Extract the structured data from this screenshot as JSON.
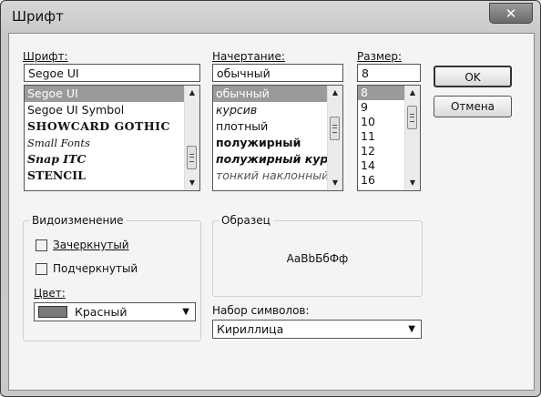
{
  "window": {
    "title": "Шрифт"
  },
  "font": {
    "label": "Шрифт:",
    "value": "Segoe UI",
    "items": [
      "Segoe UI",
      "Segoe UI Symbol",
      "SHOWCARD GOTHIC",
      "Small Fonts",
      "Snap ITC",
      "STENCIL"
    ]
  },
  "style": {
    "label": "Начертание:",
    "value": "обычный",
    "items": [
      "обычный",
      "курсив",
      "плотный",
      "полужирный",
      "полужирный курсив",
      "тонкий наклонный"
    ]
  },
  "size": {
    "label": "Размер:",
    "value": "8",
    "items": [
      "8",
      "9",
      "10",
      "11",
      "12",
      "14",
      "16"
    ]
  },
  "buttons": {
    "ok": "OK",
    "cancel": "Отмена"
  },
  "effects": {
    "title": "Видоизменение",
    "strikeout": "Зачеркнутый",
    "underline": "Подчеркнутый",
    "color_label": "Цвет:",
    "color_value": "Красный",
    "swatch_color": "#7a7a7a"
  },
  "sample": {
    "title": "Образец",
    "text": "AaBbБбФф"
  },
  "charset": {
    "label": "Набор символов:",
    "value": "Кириллица"
  }
}
